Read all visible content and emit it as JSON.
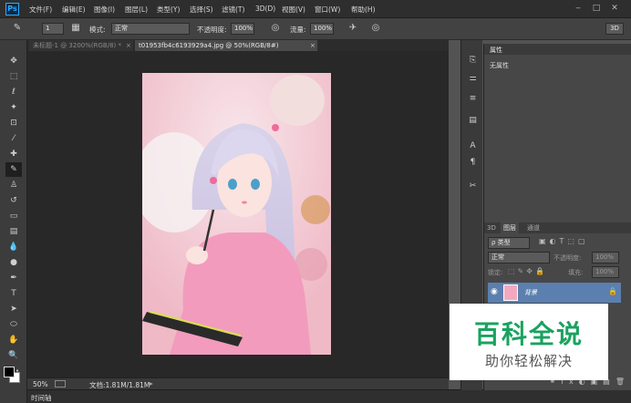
{
  "app": {
    "logo": "Ps"
  },
  "menu": [
    "文件(F)",
    "编辑(E)",
    "图像(I)",
    "图层(L)",
    "类型(Y)",
    "选择(S)",
    "滤镜(T)",
    "3D(D)",
    "视图(V)",
    "窗口(W)",
    "帮助(H)"
  ],
  "window_controls": {
    "minimize": "‒",
    "maximize": "□",
    "close": "✕"
  },
  "options": {
    "brush_size": "1",
    "mode_label": "模式:",
    "mode_value": "正常",
    "opacity_label": "不透明度:",
    "opacity_value": "100%",
    "flow_label": "流量:",
    "flow_value": "100%",
    "threed_label": "3D"
  },
  "tabs": [
    {
      "label": "未标题-1 @ 3200%(RGB/8) *",
      "close": "×"
    },
    {
      "label": "t01953fb4c6193929a4.jpg @ 50%(RGB/8#)",
      "close": "×"
    }
  ],
  "status": {
    "zoom": "50%",
    "doc": "文档:1.81M/1.81M"
  },
  "timeline": {
    "label": "时间轴"
  },
  "properties": {
    "title": "属性",
    "empty": "无属性"
  },
  "layers_panel": {
    "tabs": [
      "3D",
      "图层",
      "通道"
    ],
    "filter_label": "ρ 类型",
    "blend_mode": "正常",
    "opacity_label": "不透明度:",
    "opacity_value": "100%",
    "lock_label": "锁定:",
    "fill_label": "填充:",
    "fill_value": "100%",
    "layer_name": "背景"
  },
  "watermark": {
    "title": "百科全说",
    "subtitle": "助你轻松解决"
  }
}
